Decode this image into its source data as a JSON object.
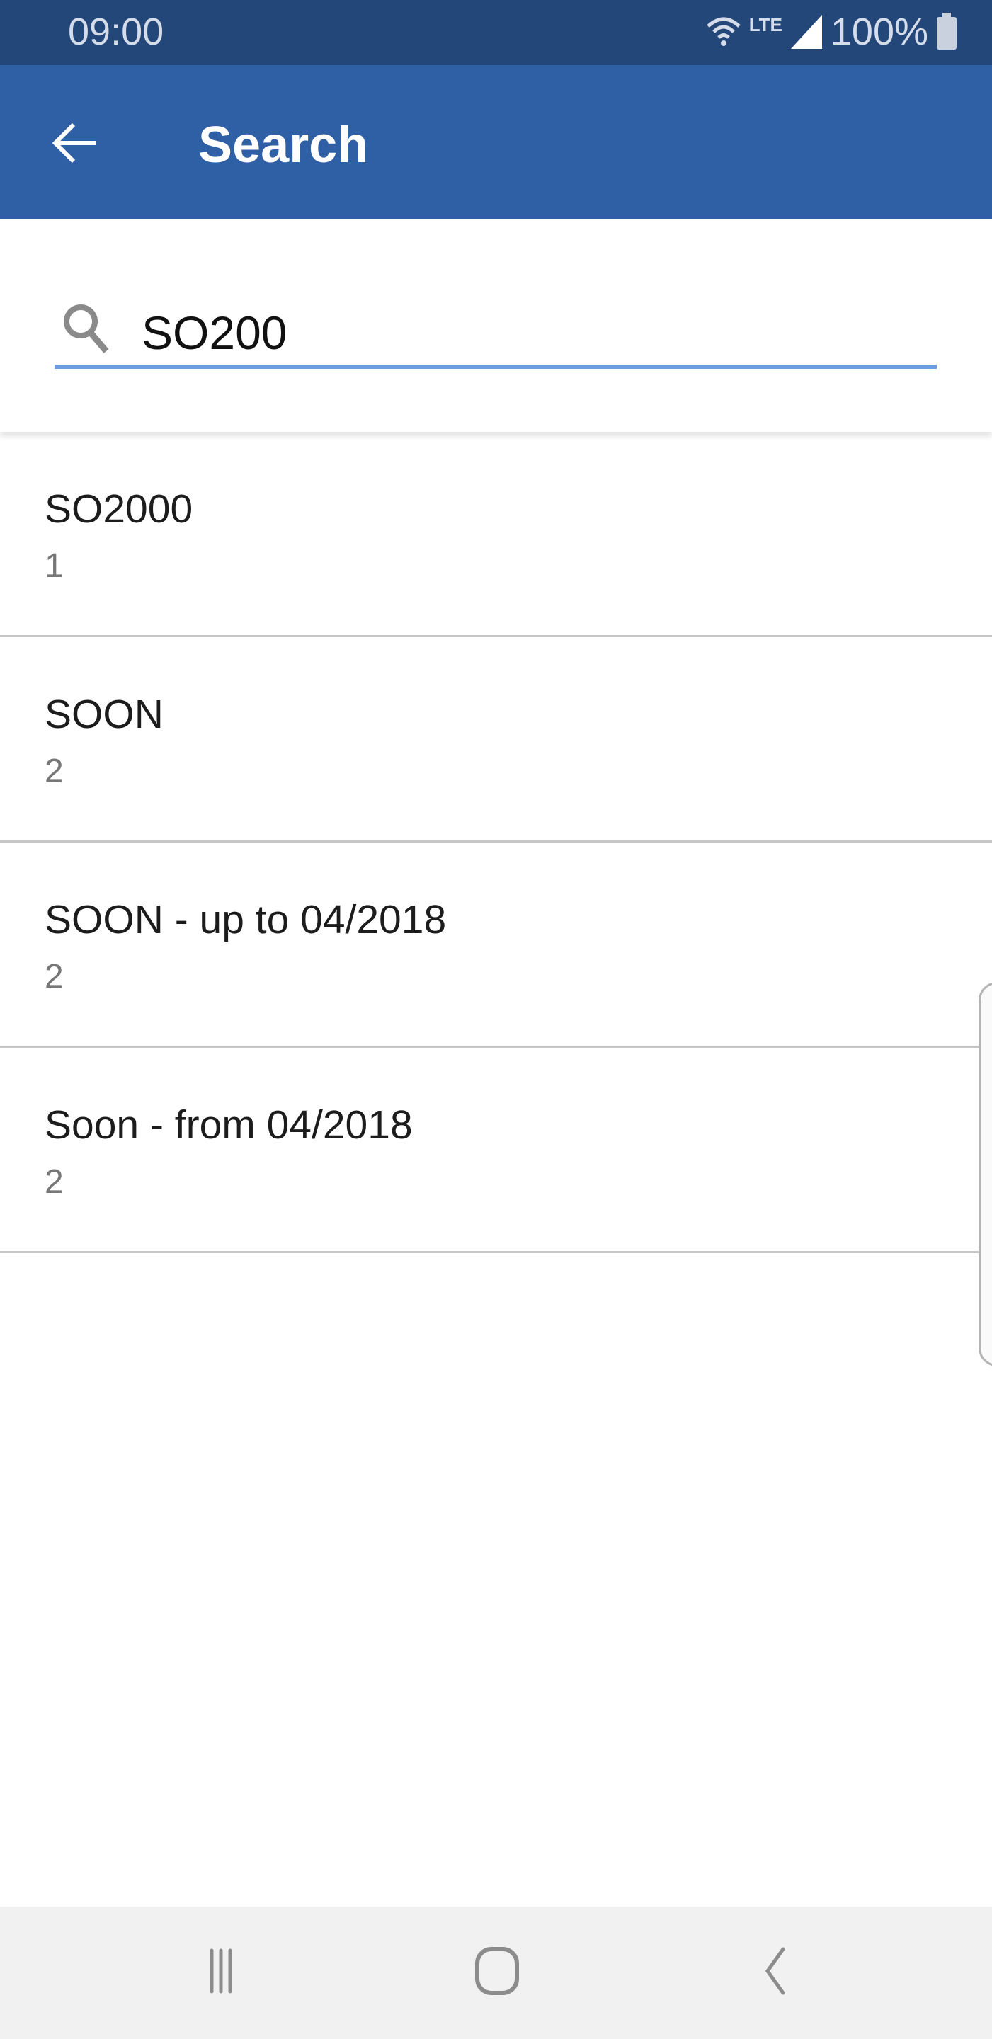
{
  "status_bar": {
    "time": "09:00",
    "network": "LTE",
    "battery": "100%"
  },
  "app_bar": {
    "title": "Search"
  },
  "search": {
    "value": "SO200",
    "underline_color": "#6f9be0"
  },
  "results": [
    {
      "title": "SO2000",
      "count": "1"
    },
    {
      "title": "SOON",
      "count": "2"
    },
    {
      "title": "SOON - up to 04/2018",
      "count": "2"
    },
    {
      "title": "Soon - from 04/2018",
      "count": "2"
    }
  ],
  "nav_bar": {
    "icons": [
      "recent-apps-icon",
      "home-icon",
      "back-icon"
    ]
  },
  "colors": {
    "status_bar": "#24477a",
    "app_bar": "#2f5fa5"
  }
}
